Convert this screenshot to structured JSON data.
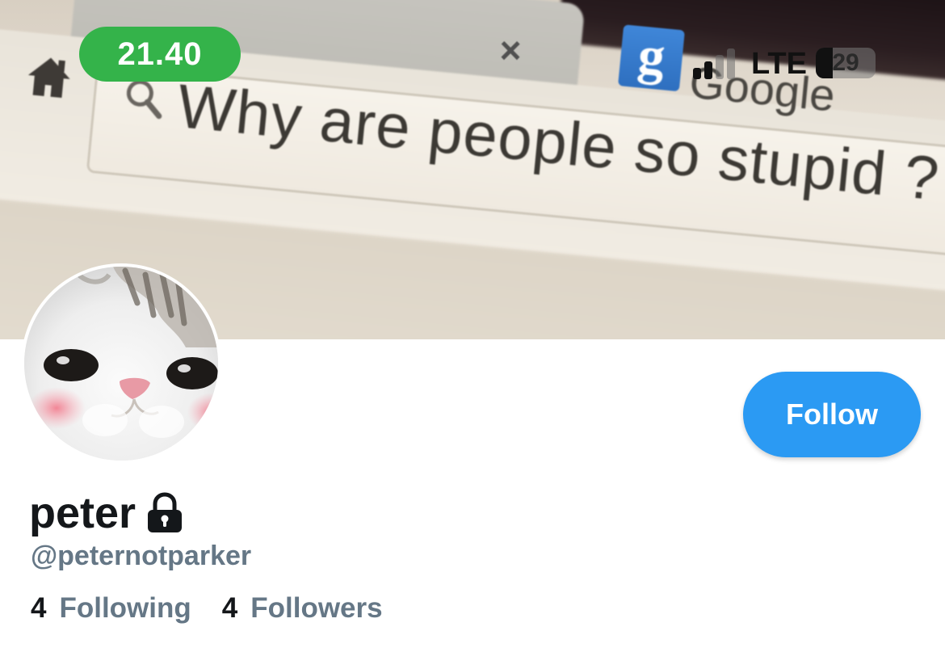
{
  "status_bar": {
    "time": "21.40",
    "network": "LTE",
    "battery_level": "29",
    "battery_fraction": 0.29,
    "signal_bars_active": 2,
    "signal_bars_total": 4
  },
  "banner": {
    "search_query": "Why are people so stupid ?",
    "search_provider": "Google",
    "search_provider_letter": "g",
    "tab_close_glyph": "×"
  },
  "profile": {
    "display_name": "peter",
    "handle": "@peternotparker",
    "protected": true,
    "following_count": "4",
    "following_label": "Following",
    "followers_count": "4",
    "followers_label": "Followers"
  },
  "actions": {
    "follow_label": "Follow"
  },
  "colors": {
    "accent": "#2b9af3",
    "time_pill": "#34b34a",
    "muted_text": "#657786",
    "primary_text": "#14171a"
  },
  "icons": {
    "home": "home-icon",
    "search": "search-icon",
    "lock": "lock-icon",
    "google": "google-icon"
  }
}
